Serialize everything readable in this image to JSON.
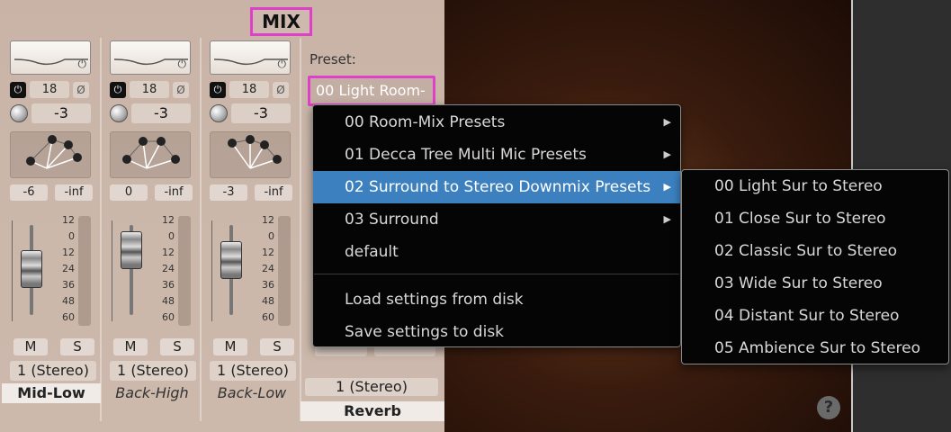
{
  "header": {
    "title": "MIX"
  },
  "strips": [
    {
      "eq_power": "⏻",
      "delay": "18",
      "phase": "Ø",
      "pan_value": "-3",
      "level_left": "-6",
      "level_right": "-inf",
      "mute": "M",
      "solo": "S",
      "routing": "1 (Stereo)",
      "name": "Mid-Low",
      "active": true
    },
    {
      "eq_power": "⏻",
      "delay": "18",
      "phase": "Ø",
      "pan_value": "-3",
      "level_left": "0",
      "level_right": "-inf",
      "mute": "M",
      "solo": "S",
      "routing": "1 (Stereo)",
      "name": "Back-High",
      "active": false
    },
    {
      "eq_power": "⏻",
      "delay": "18",
      "phase": "Ø",
      "pan_value": "-3",
      "level_left": "-3",
      "level_right": "-inf",
      "mute": "M",
      "solo": "S",
      "routing": "1 (Stereo)",
      "name": "Back-Low",
      "active": false
    }
  ],
  "fader_scale": [
    "12",
    "0",
    "12",
    "24",
    "36",
    "48",
    "60"
  ],
  "reverb": {
    "preset_label": "Preset:",
    "preset_value": "00 Light Room-",
    "routing": "1 (Stereo)",
    "name": "Reverb"
  },
  "preset_menu": {
    "items": [
      {
        "label": "00 Room-Mix Presets",
        "submenu": true
      },
      {
        "label": "01 Decca Tree Multi Mic Presets",
        "submenu": true
      },
      {
        "label": "02 Surround to Stereo Downmix Presets",
        "submenu": true,
        "highlighted": true
      },
      {
        "label": "03 Surround",
        "submenu": true
      },
      {
        "label": "default",
        "submenu": false
      },
      {
        "label": "Load settings from disk",
        "submenu": false
      },
      {
        "label": "Save settings to disk",
        "submenu": false
      }
    ]
  },
  "submenu": {
    "items": [
      "00 Light Sur to Stereo",
      "01 Close Sur to Stereo",
      "02 Classic Sur to Stereo",
      "03 Wide Sur to Stereo",
      "04 Distant Sur to Stereo",
      "05 Ambience Sur to Stereo"
    ]
  },
  "help": {
    "label": "?"
  },
  "colors": {
    "highlight": "#3c80bf",
    "annotation": "#e040c8",
    "menu_bg": "#050505"
  }
}
